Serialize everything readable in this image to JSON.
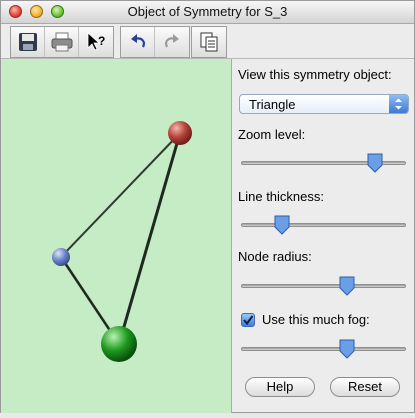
{
  "window": {
    "title": "Object of Symmetry for S_3"
  },
  "panel": {
    "symmetry_label": "View this symmetry object:",
    "symmetry_selected": "Triangle",
    "zoom_label": "Zoom level:",
    "zoom_value": 0.81,
    "thickness_label": "Line thickness:",
    "thickness_value": 0.25,
    "radius_label": "Node radius:",
    "radius_value": 0.64,
    "fog_label": "Use this much fog:",
    "fog_checked": true,
    "fog_value": 0.64,
    "help_label": "Help",
    "reset_label": "Reset"
  },
  "scene": {
    "nodes": [
      {
        "name": "red-node",
        "color": "#b5433a"
      },
      {
        "name": "blue-node",
        "color": "#6f86c9"
      },
      {
        "name": "green-node",
        "color": "#1f9a1f"
      }
    ]
  },
  "toolbar": {
    "icons": [
      "save-icon",
      "print-icon",
      "help-cursor-icon",
      "undo-icon",
      "redo-icon",
      "copy-icon"
    ]
  }
}
